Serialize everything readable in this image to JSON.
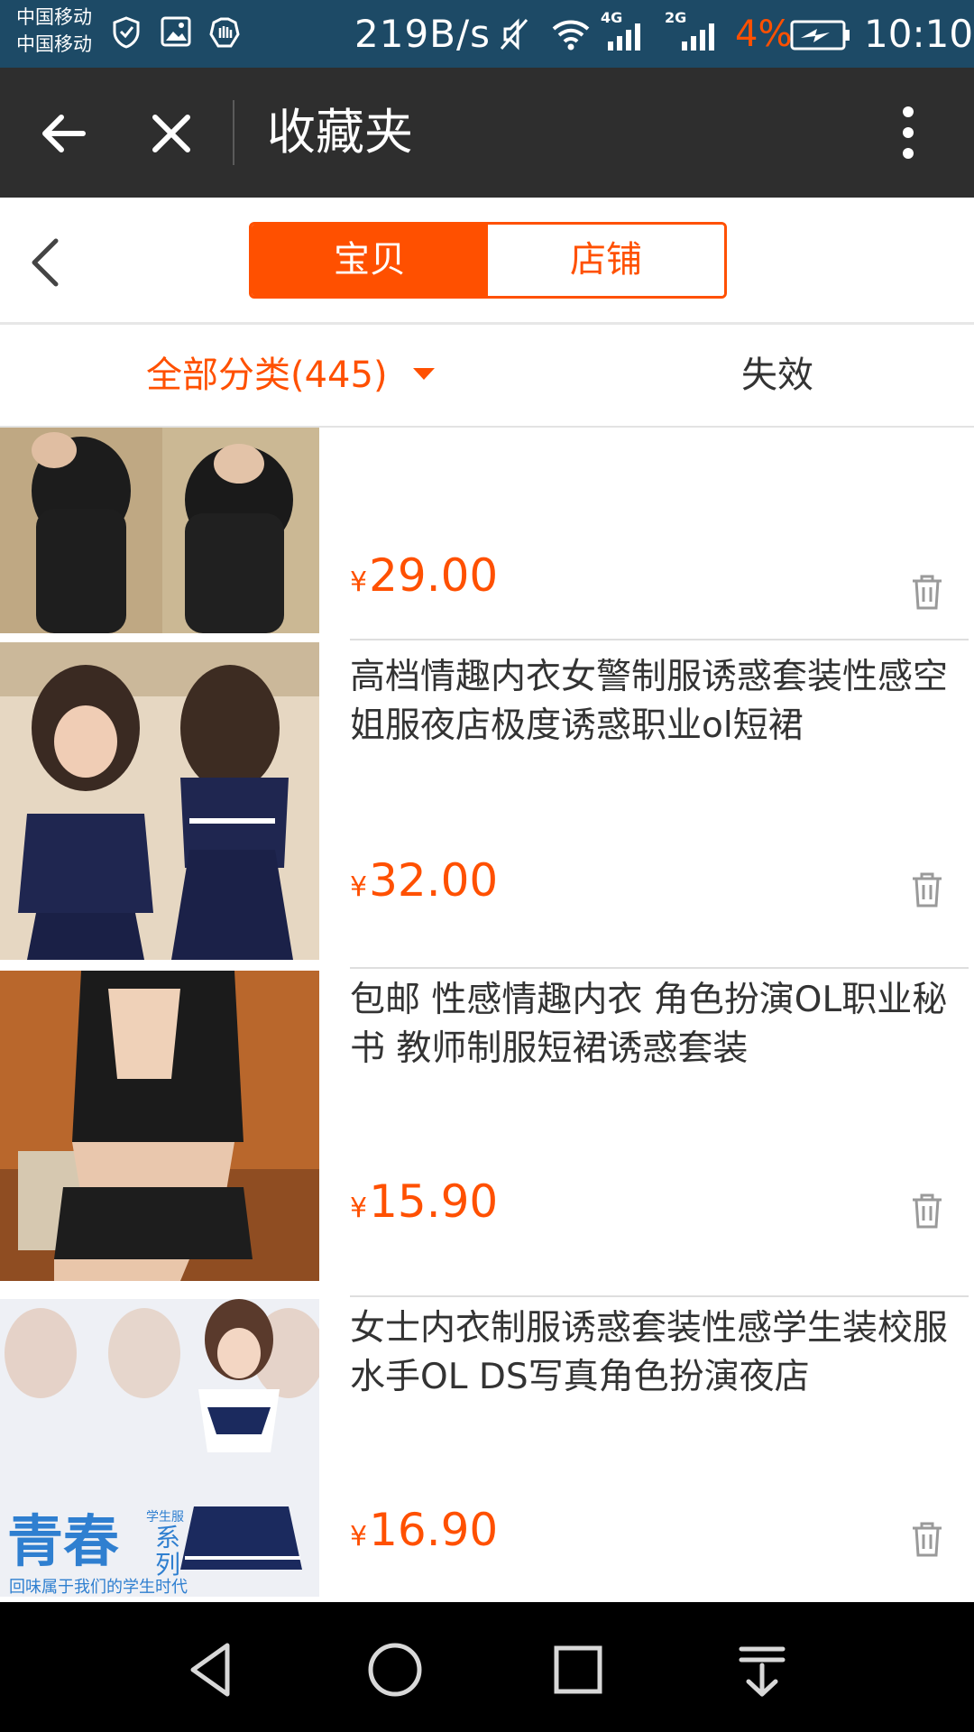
{
  "status_bar": {
    "carrier_1": "中国移动",
    "carrier_2": "中国移动",
    "net_speed": "219B/s",
    "sig_label_1": "4G",
    "sig_label_2": "2G",
    "battery_percent": "4%",
    "time": "10:10",
    "battery_color": "#ff5000"
  },
  "title_bar": {
    "title": "收藏夹",
    "icons": [
      "back-arrow-icon",
      "close-icon",
      "more-vertical-icon"
    ]
  },
  "tabs": {
    "items": [
      {
        "label": "宝贝",
        "active": true
      },
      {
        "label": "店铺",
        "active": false
      }
    ]
  },
  "filter": {
    "all_label": "全部分类(445)",
    "invalid_label": "失效"
  },
  "items": [
    {
      "title": "",
      "price": "29.00",
      "currency": "¥",
      "thumb_colors": [
        "#d8c7a6",
        "#1c1c1c"
      ]
    },
    {
      "title": "高档情趣内衣女警制服诱惑套装性感空姐服夜店极度诱惑职业ol短裙",
      "price": "32.00",
      "currency": "¥",
      "thumb_colors": [
        "#e9dccb",
        "#1f2650"
      ]
    },
    {
      "title": "包邮 性感情趣内衣 角色扮演OL职业秘书 教师制服短裙诱惑套装",
      "price": "15.90",
      "currency": "¥",
      "thumb_colors": [
        "#b5652a",
        "#1a1a1a"
      ]
    },
    {
      "title": "女士内衣制服诱惑套装性感学生装校服水手OL DS写真角色扮演夜店",
      "price": "16.90",
      "currency": "¥",
      "thumb_colors": [
        "#eef0f6",
        "#1b2a5e"
      ],
      "thumb_text": {
        "main": "青春",
        "side_top": "学生服",
        "side": "系列",
        "caption": "回味属于我们的学生时代"
      }
    }
  ],
  "accent_color": "#ff5000",
  "nav_bar": {
    "icons": [
      "nav-back-icon",
      "nav-home-icon",
      "nav-recents-icon",
      "nav-notification-icon"
    ]
  }
}
